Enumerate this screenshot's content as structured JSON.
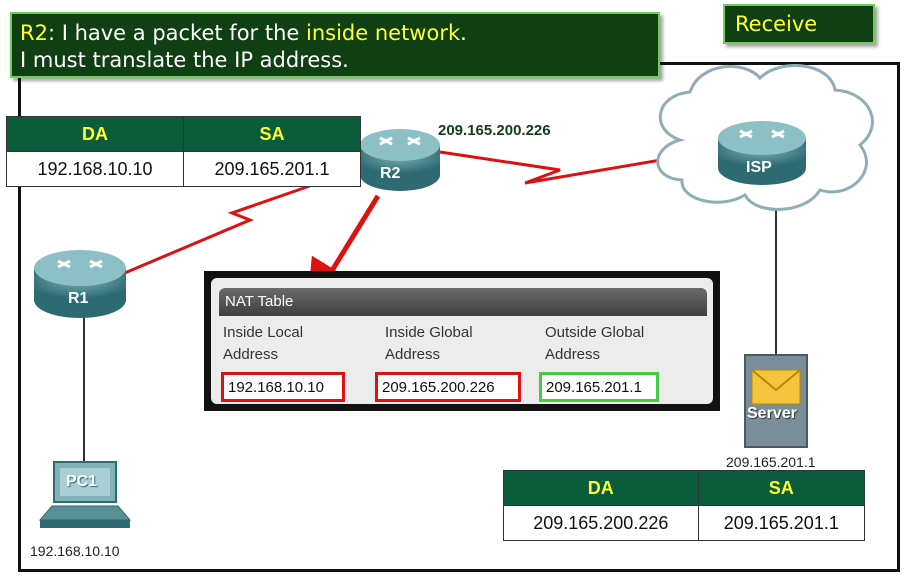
{
  "caption": {
    "prefix": "R2",
    "part1": ": I have a packet for the ",
    "highlight": "inside network",
    "part2": ".",
    "line2": "I must translate the IP address."
  },
  "badge": "Receive",
  "packet_top": {
    "da_label": "DA",
    "sa_label": "SA",
    "da": "192.168.10.10",
    "sa": "209.165.201.1"
  },
  "packet_bottom": {
    "da_label": "DA",
    "sa_label": "SA",
    "da": "209.165.200.226",
    "sa": "209.165.201.1"
  },
  "devices": {
    "r1": "R1",
    "r2": "R2",
    "isp": "ISP",
    "server": "Server",
    "pc": "PC1"
  },
  "addresses": {
    "r2_link": "209.165.200.226",
    "server": "209.165.201.1",
    "pc": "192.168.10.10"
  },
  "nat_table": {
    "title": "NAT Table",
    "columns": [
      {
        "line1": "Inside Local",
        "line2": "Address"
      },
      {
        "line1": "Inside Global",
        "line2": "Address"
      },
      {
        "line1": "Outside Global",
        "line2": "Address"
      }
    ],
    "row": [
      "192.168.10.10",
      "209.165.200.226",
      "209.165.201.1"
    ]
  },
  "colors": {
    "caption_bg": "#0f3f12",
    "highlight": "#ffff33",
    "header_bg": "#0b5c3a",
    "link": "#dd1111",
    "translated_border": "#dd1111",
    "outside_border": "#44cc44",
    "device": "#3f7f86"
  }
}
